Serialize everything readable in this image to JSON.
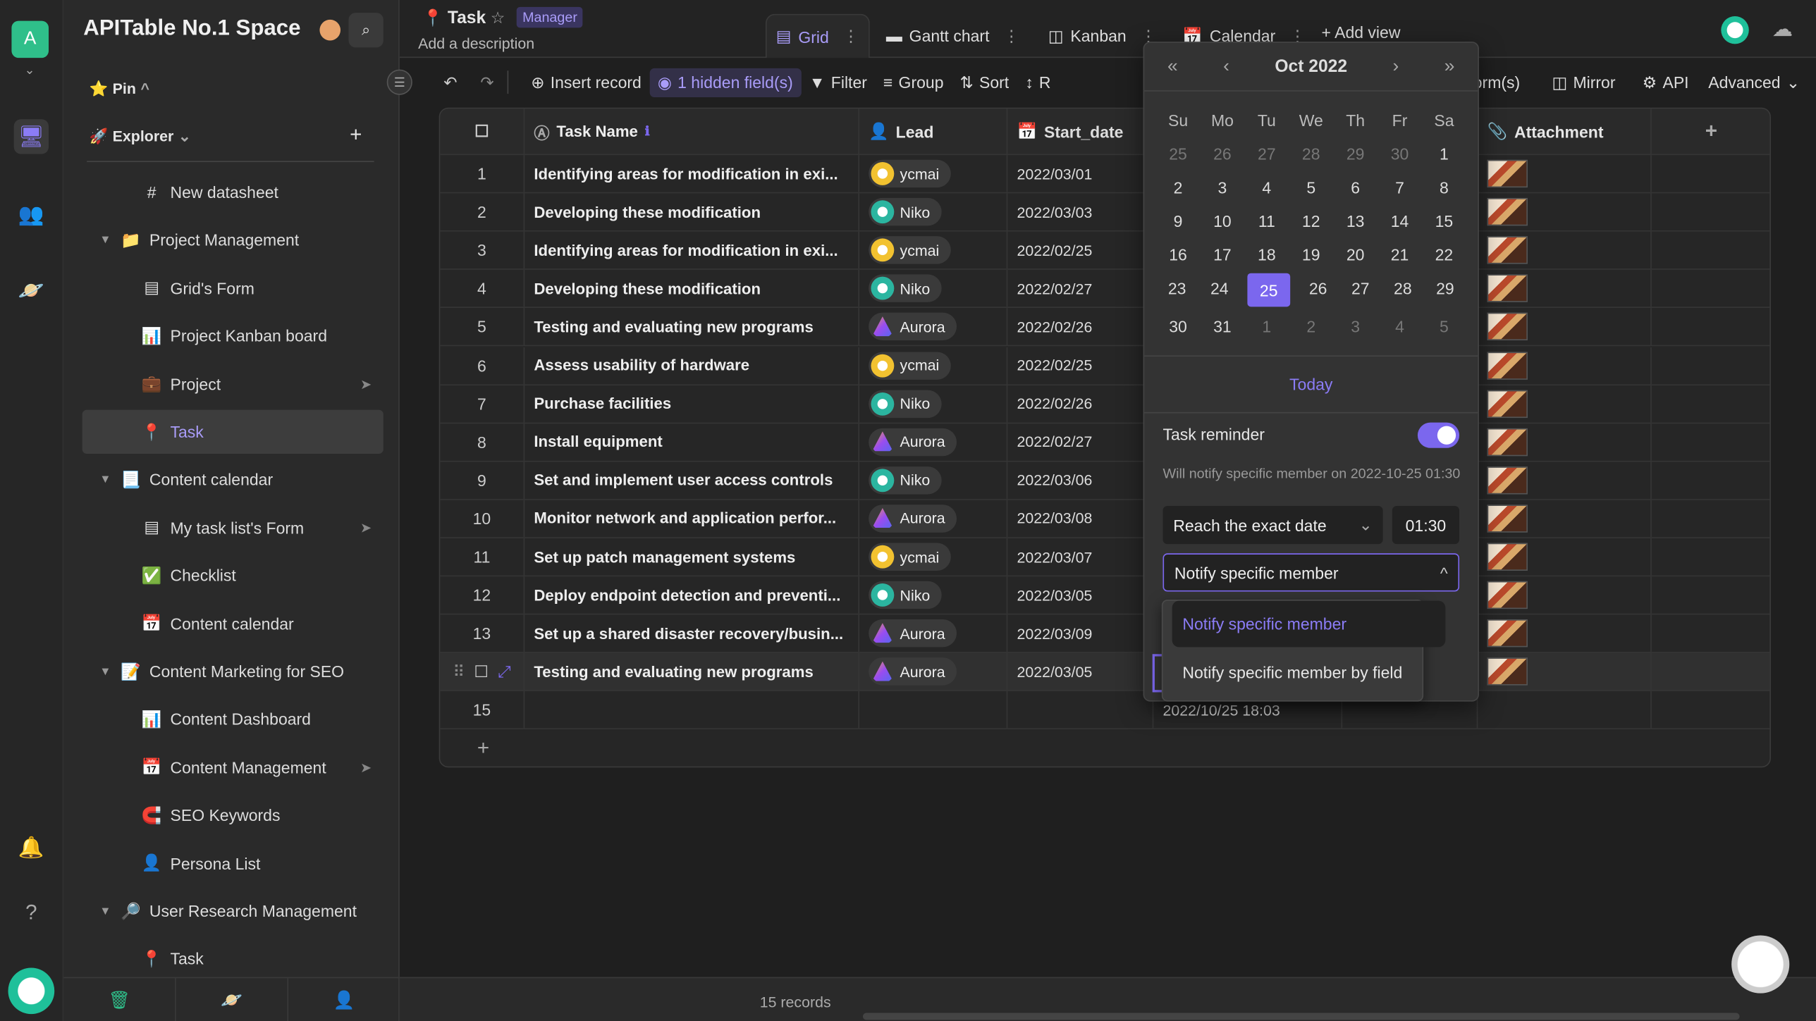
{
  "rail": {
    "logo_letter": "A",
    "icons": [
      "monitor-icon",
      "users-icon",
      "planet-icon",
      "bell-icon",
      "help-icon"
    ]
  },
  "sidebar": {
    "space_title": "APITable No.1 Space",
    "pin_label": "Pin",
    "explorer_label": "Explorer",
    "items": [
      {
        "label": "New datasheet",
        "emoji": "#",
        "level": 1
      },
      {
        "label": "Project Management",
        "emoji": "📁",
        "level": 0,
        "folder": true
      },
      {
        "label": "Grid's Form",
        "emoji": "▤",
        "level": 1
      },
      {
        "label": "Project Kanban board",
        "emoji": "📊",
        "level": 1
      },
      {
        "label": "Project",
        "emoji": "💼",
        "level": 1,
        "shared": true
      },
      {
        "label": "Task",
        "emoji": "📍",
        "level": 1,
        "active": true
      },
      {
        "label": "Content calendar",
        "emoji": "📃",
        "level": 0,
        "folder": true
      },
      {
        "label": "My task list's Form",
        "emoji": "▤",
        "level": 1,
        "shared": true
      },
      {
        "label": "Checklist",
        "emoji": "✅",
        "level": 1
      },
      {
        "label": "Content calendar",
        "emoji": "📅",
        "level": 1
      },
      {
        "label": "Content Marketing for SEO",
        "emoji": "📝",
        "level": 0,
        "folder": true
      },
      {
        "label": "Content Dashboard",
        "emoji": "📊",
        "level": 1
      },
      {
        "label": "Content Management",
        "emoji": "📅",
        "level": 1,
        "shared": true
      },
      {
        "label": "SEO Keywords",
        "emoji": "🧲",
        "level": 1
      },
      {
        "label": "Persona List",
        "emoji": "👤",
        "level": 1
      },
      {
        "label": "User Research Management",
        "emoji": "🔎",
        "level": 0,
        "folder": true
      },
      {
        "label": "Task",
        "emoji": "📍",
        "level": 1
      }
    ]
  },
  "header": {
    "title": "Task",
    "role_badge": "Manager",
    "description": "Add a description",
    "tabs": [
      {
        "label": "Grid",
        "icon": "grid-icon",
        "active": true
      },
      {
        "label": "Gantt chart",
        "icon": "gantt-icon"
      },
      {
        "label": "Kanban",
        "icon": "kanban-icon"
      },
      {
        "label": "Calendar",
        "icon": "calendar-icon"
      }
    ],
    "add_view": "+ Add view"
  },
  "toolbar": {
    "insert": "Insert record",
    "hidden": "1 hidden field(s)",
    "filter": "Filter",
    "group": "Group",
    "sort": "Sort",
    "row_height": "R",
    "forms": "orm(s)",
    "mirror": "Mirror",
    "api": "API",
    "advanced": "Advanced"
  },
  "grid": {
    "columns": {
      "name": "Task Name",
      "lead": "Lead",
      "start": "Start_date",
      "attachment": "Attachment"
    },
    "rows": [
      {
        "n": "1",
        "name": "Identifying areas for modification in exi...",
        "lead": "ycmai",
        "start": "2022/03/01"
      },
      {
        "n": "2",
        "name": "Developing these modification",
        "lead": "Niko",
        "start": "2022/03/03"
      },
      {
        "n": "3",
        "name": "Identifying areas for modification in exi...",
        "lead": "ycmai",
        "start": "2022/02/25"
      },
      {
        "n": "4",
        "name": "Developing these modification",
        "lead": "Niko",
        "start": "2022/02/27"
      },
      {
        "n": "5",
        "name": "Testing and evaluating new programs",
        "lead": "Aurora",
        "start": "2022/02/26"
      },
      {
        "n": "6",
        "name": "Assess usability of hardware",
        "lead": "ycmai",
        "start": "2022/02/25"
      },
      {
        "n": "7",
        "name": "Purchase facilities",
        "lead": "Niko",
        "start": "2022/02/26"
      },
      {
        "n": "8",
        "name": "Install equipment",
        "lead": "Aurora",
        "start": "2022/02/27"
      },
      {
        "n": "9",
        "name": "Set and implement user access controls",
        "lead": "Niko",
        "start": "2022/03/06"
      },
      {
        "n": "10",
        "name": "Monitor network and application perfor...",
        "lead": "Aurora",
        "start": "2022/03/08"
      },
      {
        "n": "11",
        "name": "Set up patch management systems",
        "lead": "ycmai",
        "start": "2022/03/07"
      },
      {
        "n": "12",
        "name": "Deploy endpoint detection and preventi...",
        "lead": "Niko",
        "start": "2022/03/05"
      },
      {
        "n": "13",
        "name": "Set up a shared disaster recovery/busin...",
        "lead": "Aurora",
        "start": "2022/03/09"
      },
      {
        "n": "",
        "name": "Testing and evaluating new programs",
        "lead": "Aurora",
        "start": "2022/03/05",
        "hover": true
      },
      {
        "n": "15",
        "name": "",
        "lead": "",
        "start": "",
        "datetime": "2022/10/25 18:03",
        "empty": true
      }
    ],
    "record_count": "15 records"
  },
  "calendar": {
    "month": "Oct 2022",
    "weekdays": [
      "Su",
      "Mo",
      "Tu",
      "We",
      "Th",
      "Fr",
      "Sa"
    ],
    "weeks": [
      [
        "25",
        "26",
        "27",
        "28",
        "29",
        "30",
        "1"
      ],
      [
        "2",
        "3",
        "4",
        "5",
        "6",
        "7",
        "8"
      ],
      [
        "9",
        "10",
        "11",
        "12",
        "13",
        "14",
        "15"
      ],
      [
        "16",
        "17",
        "18",
        "19",
        "20",
        "21",
        "22"
      ],
      [
        "23",
        "24",
        "25",
        "26",
        "27",
        "28",
        "29"
      ],
      [
        "30",
        "31",
        "1",
        "2",
        "3",
        "4",
        "5"
      ]
    ],
    "selected": "25",
    "today": "Today"
  },
  "reminder": {
    "label": "Task reminder",
    "enabled": true,
    "note": "Will notify specific member on 2022-10-25 01:30",
    "when": "Reach the exact date",
    "time": "01:30",
    "notify_value": "Notify specific member",
    "options": [
      "Notify specific member",
      "Notify specific member by field"
    ]
  },
  "colors": {
    "accent": "#7b67ee",
    "bg": "#1f1f1f"
  }
}
